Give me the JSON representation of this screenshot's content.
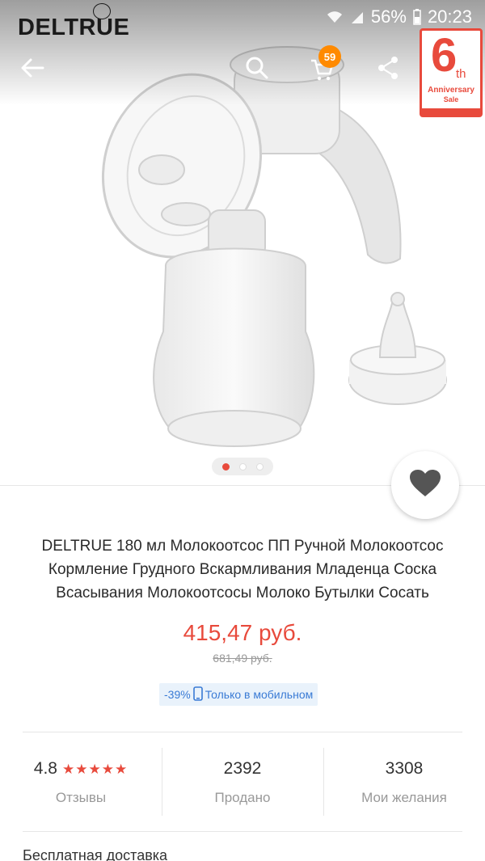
{
  "status_bar": {
    "brand": "DELTRUE",
    "battery": "56%",
    "time": "20:23"
  },
  "toolbar": {
    "back_icon": "arrow-left-icon",
    "search_icon": "search-icon",
    "cart_icon": "cart-icon",
    "cart_count": "59",
    "share_icon": "share-icon"
  },
  "anniversary_badge": {
    "number": "6",
    "suffix": "th",
    "line1": "Anniversary",
    "line2": "Sale"
  },
  "gallery": {
    "slides_total": 3,
    "active_index": 0
  },
  "product": {
    "title": "DELTRUE 180 мл Молокоотсос ПП Ручной Молокоотсос Кормление Грудного Вскармливания Младенца Соска Всасывания Молокоотсосы Молоко Бутылки Сосать",
    "price": "415,47 руб.",
    "old_price": "681,49 руб.",
    "discount": "-39%",
    "mobile_only": "Только в мобильном"
  },
  "stats": {
    "rating": "4.8",
    "rating_stars": 5,
    "reviews_label": "Отзывы",
    "sold_value": "2392",
    "sold_label": "Продано",
    "wishlist_value": "3308",
    "wishlist_label": "Мои желания"
  },
  "delivery": {
    "label": "Бесплатная доставка"
  },
  "colors": {
    "accent": "#e84a3c",
    "badge": "#ff8a00",
    "promo_text": "#3a7bd5"
  }
}
